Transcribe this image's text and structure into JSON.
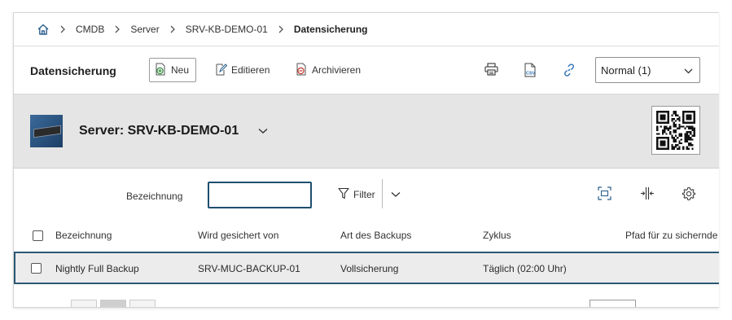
{
  "breadcrumb": {
    "items": [
      "CMDB",
      "Server",
      "SRV-KB-DEMO-01"
    ],
    "current": "Datensicherung"
  },
  "toolbar": {
    "title": "Datensicherung",
    "new_label": "Neu",
    "edit_label": "Editieren",
    "archive_label": "Archivieren",
    "view_select": "Normal (1)"
  },
  "object": {
    "title": "Server: SRV-KB-DEMO-01"
  },
  "filter": {
    "label": "Bezeichnung",
    "value": "",
    "filter_label": "Filter"
  },
  "table": {
    "columns": [
      "Bezeichnung",
      "Wird gesichert von",
      "Art des Backups",
      "Zyklus",
      "Pfad für zu sichernde"
    ],
    "rows": [
      [
        "Nightly Full Backup",
        "SRV-MUC-BACKUP-01",
        "Vollsicherung",
        "Täglich (02:00 Uhr)",
        ""
      ]
    ]
  },
  "colors": {
    "accent": "#1f4f6f",
    "link_icon": "#2a6fb5",
    "header_bg": "#e5e5e5"
  }
}
